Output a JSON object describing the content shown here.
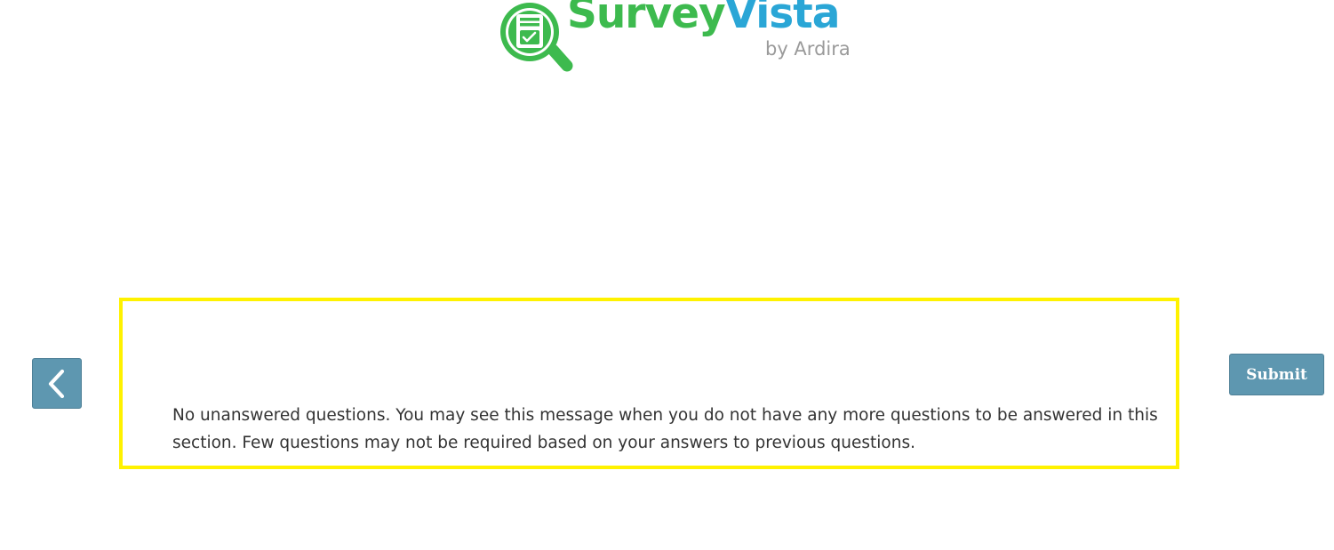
{
  "logo": {
    "brand_part1": "Survey",
    "brand_part2": "Vista",
    "byline": "by Ardira",
    "icon": "magnifier-survey-icon",
    "colors": {
      "green": "#3dba4e",
      "blue": "#2aa6d6",
      "grey": "#9a9a9a"
    }
  },
  "message": {
    "text": "No unanswered questions. You may see this message when you do not have any more questions to be answered in this section. Few questions may not be required based on your answers to previous questions.",
    "border_color": "#fff200"
  },
  "navigation": {
    "back_icon": "chevron-left-icon",
    "submit_label": "Submit",
    "button_color": "#5e97b0"
  }
}
